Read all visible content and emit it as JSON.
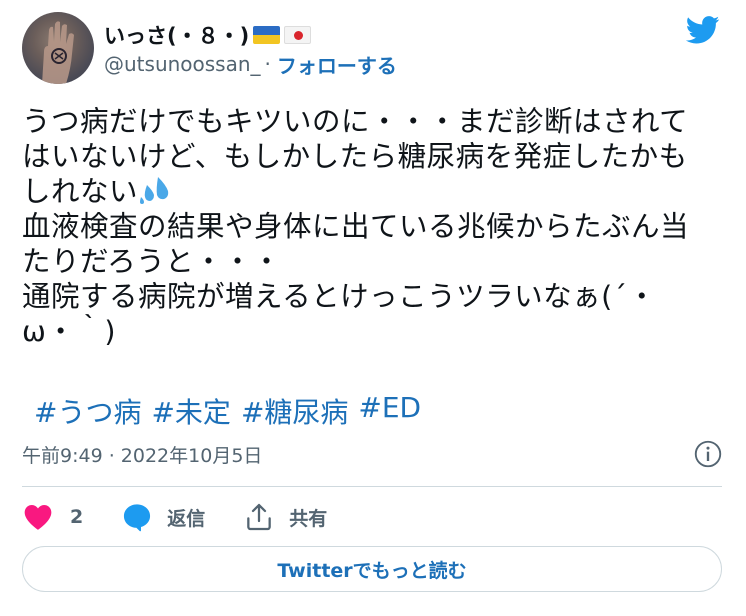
{
  "author": {
    "display_name": "いっさ(・８・)",
    "handle": "@utsunoossan_",
    "separator": "·",
    "follow_label": "フォローする"
  },
  "tweet": {
    "lines": [
      "うつ病だけでもキツいのに・・・まだ診断はされて",
      "はいないけど、もしかしたら糖尿病を発症したかも",
      "しれない",
      "血液検査の結果や身体に出ている兆候からたぶん当",
      "たりだろうと・・・",
      "通院する病院が増えるとけっこうツラいなぁ(´・",
      "ω・｀)"
    ],
    "hashtags": [
      "#うつ病",
      "#未定",
      "#糖尿病",
      "#ED"
    ],
    "timestamp": "午前9:49 · 2022年10月5日"
  },
  "actions": {
    "like_count": "2",
    "reply_label": "返信",
    "share_label": "共有"
  },
  "read_more_label": "Twitterでもっと読む",
  "colors": {
    "link": "#1d70b8",
    "twitter_blue": "#1d9bf0",
    "heart": "#f91880",
    "muted": "#536471"
  },
  "icons": [
    "ukraine-flag-icon",
    "japan-flag-icon",
    "twitter-bird-icon",
    "sweat-droplets-icon",
    "info-icon",
    "heart-icon",
    "reply-bubble-icon",
    "share-icon"
  ]
}
